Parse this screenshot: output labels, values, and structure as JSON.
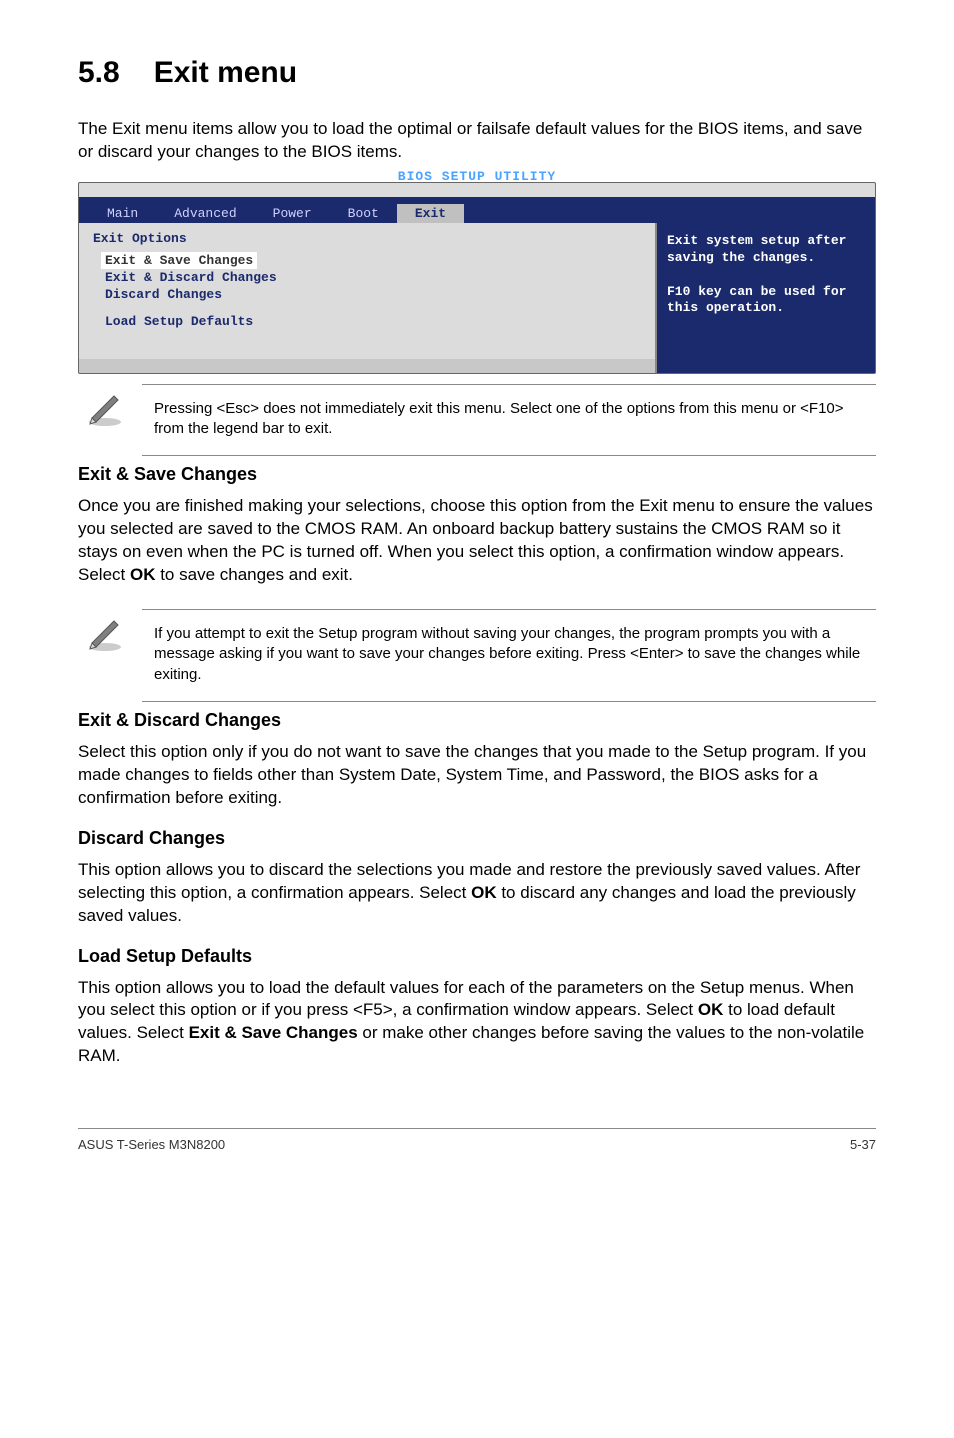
{
  "section": {
    "number": "5.8",
    "title": "Exit menu"
  },
  "intro": "The Exit menu items allow you to load the optimal or failsafe default values for the BIOS items, and save or discard your changes to the BIOS items.",
  "bios": {
    "utility_title": "BIOS SETUP UTILITY",
    "tabs": [
      "Main",
      "Advanced",
      "Power",
      "Boot",
      "Exit"
    ],
    "active_tab": "Exit",
    "left": {
      "heading": "Exit Options",
      "items": [
        "Exit & Save Changes",
        "Exit & Discard Changes",
        "Discard Changes",
        "",
        "Load Setup Defaults"
      ],
      "selected_index": 0
    },
    "help": "Exit system setup after saving the changes.\n\nF10 key can be used for this operation."
  },
  "note1": "Pressing <Esc> does not immediately exit this menu. Select one of the options from this menu or <F10> from the legend bar to exit.",
  "sub1": {
    "title": "Exit & Save Changes",
    "body_pre": "Once you are finished making your selections, choose this option from the Exit menu to ensure the values you selected are saved to the CMOS RAM. An onboard backup battery sustains the CMOS RAM so it stays on even when the PC is turned off. When you select this option, a confirmation window appears. Select ",
    "body_bold": "OK",
    "body_post": " to save changes and exit."
  },
  "note2": " If you attempt to exit the Setup program without saving your changes, the program prompts you with a message asking if you want to save your changes before exiting. Press <Enter>  to save the  changes while exiting.",
  "sub2": {
    "title": "Exit & Discard Changes",
    "body": "Select this option only if you do not want to save the changes that you  made to the Setup program. If you made changes to fields other than System Date, System Time, and Password, the BIOS asks for a confirmation before exiting."
  },
  "sub3": {
    "title": "Discard Changes",
    "body_pre": "This option allows you to discard the selections you made and restore the previously saved values. After selecting this option, a confirmation appears. Select ",
    "body_bold": "OK",
    "body_post": " to discard any changes and load the previously saved values."
  },
  "sub4": {
    "title": "Load Setup Defaults",
    "body_pre": "This option allows you to load the default values for each of the parameters on the Setup menus. When you select this option or if you press <F5>, a confirmation window appears. Select ",
    "body_bold1": "OK",
    "body_mid": " to load default values. Select ",
    "body_bold2": "Exit & Save Changes",
    "body_post": " or make other changes before saving the values to the non-volatile RAM."
  },
  "footer": {
    "left": "ASUS T-Series M3N8200",
    "right": "5-37"
  }
}
